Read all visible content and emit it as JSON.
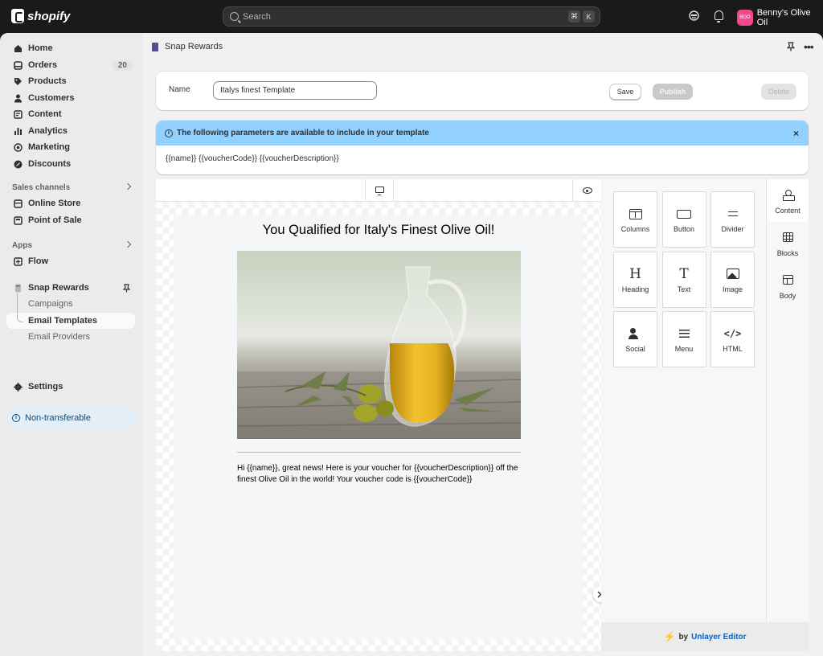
{
  "topbar": {
    "logo_text": "shopify",
    "search_placeholder": "Search",
    "shortcut_keys": [
      "⌘",
      "K"
    ],
    "store_name": "Benny's Olive Oil",
    "avatar_initials": "BOO",
    "avatar_color": "#f04a8c"
  },
  "sidebar": {
    "main_items": [
      {
        "label": "Home",
        "icon": "home-icon"
      },
      {
        "label": "Orders",
        "icon": "orders-icon",
        "badge": "20"
      },
      {
        "label": "Products",
        "icon": "tag-icon"
      },
      {
        "label": "Customers",
        "icon": "person-icon"
      },
      {
        "label": "Content",
        "icon": "content-icon"
      },
      {
        "label": "Analytics",
        "icon": "bar-chart-icon"
      },
      {
        "label": "Marketing",
        "icon": "target-icon"
      },
      {
        "label": "Discounts",
        "icon": "discount-icon"
      }
    ],
    "sales_channels_label": "Sales channels",
    "sales_channels": [
      {
        "label": "Online Store",
        "icon": "store-icon"
      },
      {
        "label": "Point of Sale",
        "icon": "pos-icon"
      }
    ],
    "apps_label": "Apps",
    "apps": [
      {
        "label": "Flow",
        "icon": "flow-icon"
      }
    ],
    "app_name": "Snap Rewards",
    "app_sub_items": [
      "Campaigns",
      "Email Templates",
      "Email Providers"
    ],
    "settings_label": "Settings",
    "non_transferable_label": "Non-transferable"
  },
  "app_header": {
    "title": "Snap Rewards"
  },
  "template_form": {
    "name_label": "Name",
    "name_value": "Italys finest Template",
    "save_label": "Save",
    "publish_label": "Publish",
    "delete_label": "Delete"
  },
  "banner": {
    "title": "The following parameters are available to include in your template",
    "params": "{{name}} {{voucherCode}} {{voucherDescription}}",
    "close_symbol": "×"
  },
  "email": {
    "heading": "You Qualified for Italy's Finest Olive Oil!",
    "body": "Hi {{name}}, great news! Here is your voucher for {{voucherDescription}} off the finest Olive Oil in the world! Your voucher code is {{voucherCode}}"
  },
  "tools": [
    {
      "label": "Columns",
      "icon": "columns-icon"
    },
    {
      "label": "Button",
      "icon": "button-icon"
    },
    {
      "label": "Divider",
      "icon": "divider-icon"
    },
    {
      "label": "Heading",
      "icon": "heading-icon",
      "glyph": "H"
    },
    {
      "label": "Text",
      "icon": "text-icon",
      "glyph": "T"
    },
    {
      "label": "Image",
      "icon": "image-icon"
    },
    {
      "label": "Social",
      "icon": "social-icon"
    },
    {
      "label": "Menu",
      "icon": "menu-icon"
    },
    {
      "label": "HTML",
      "icon": "code-icon",
      "glyph": "</>"
    }
  ],
  "side_tabs": [
    {
      "label": "Content",
      "active": true
    },
    {
      "label": "Blocks"
    },
    {
      "label": "Body"
    }
  ],
  "footer": {
    "by": "by",
    "brand": "Unlayer Editor",
    "brand_color": "#0b62c4"
  },
  "colors": {
    "topbar": "#1a1a1a",
    "banner": "#91d0ff",
    "notice": "#e3eef7"
  }
}
